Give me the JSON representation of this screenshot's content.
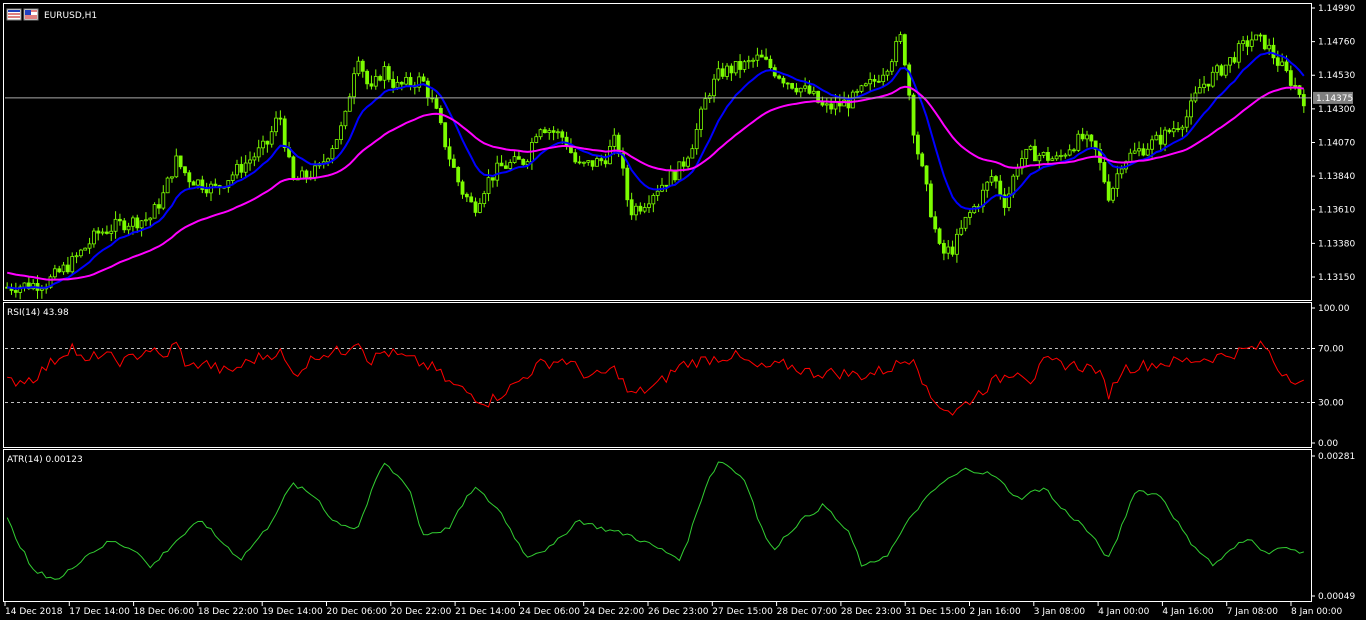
{
  "window": {
    "symbol_title": "EURUSD,H1",
    "icons": [
      "chart-window-icon",
      "flag-icon"
    ]
  },
  "colors": {
    "background": "#000000",
    "grid_border": "#ffffff",
    "candle_up": "#7cfc00",
    "candle_down": "#7cfc00",
    "ma_fast": "#0000ff",
    "ma_slow": "#ff00ff",
    "rsi_line": "#ff0000",
    "atr_line": "#32cd32",
    "level_line": "#c0c0c0"
  },
  "price_panel": {
    "y_ticks": [
      "1.14990",
      "1.14760",
      "1.14530",
      "1.14300",
      "1.14070",
      "1.13840",
      "1.13610",
      "1.13380",
      "1.13150"
    ],
    "current_price": "1.14375"
  },
  "rsi_panel": {
    "title": "RSI(14) 43.98",
    "y_ticks": [
      "100.00",
      "70.00",
      "30.00",
      "0.00"
    ],
    "levels": [
      70,
      30
    ]
  },
  "atr_panel": {
    "title": "ATR(14) 0.00123",
    "y_ticks": [
      "0.00281",
      "0.00049"
    ]
  },
  "x_axis": {
    "labels": [
      "14 Dec 2018",
      "17 Dec 14:00",
      "18 Dec 06:00",
      "18 Dec 22:00",
      "19 Dec 14:00",
      "20 Dec 06:00",
      "20 Dec 22:00",
      "21 Dec 14:00",
      "24 Dec 06:00",
      "24 Dec 22:00",
      "26 Dec 23:00",
      "27 Dec 15:00",
      "28 Dec 07:00",
      "28 Dec 23:00",
      "31 Dec 15:00",
      "2 Jan 16:00",
      "3 Jan 08:00",
      "4 Jan 00:00",
      "4 Jan 16:00",
      "7 Jan 08:00",
      "8 Jan 00:00"
    ]
  },
  "chart_data": [
    {
      "type": "candlestick",
      "title": "EURUSD,H1",
      "ylim": [
        1.1302,
        1.1499
      ],
      "x_range_labels": [
        "14 Dec 2018",
        "8 Jan 00:00"
      ],
      "close_profile": [
        [
          0,
          1.1308
        ],
        [
          0.03,
          1.1311
        ],
        [
          0.05,
          1.1325
        ],
        [
          0.07,
          1.1345
        ],
        [
          0.09,
          1.1352
        ],
        [
          0.11,
          1.1355
        ],
        [
          0.12,
          1.137
        ],
        [
          0.13,
          1.1395
        ],
        [
          0.14,
          1.1383
        ],
        [
          0.16,
          1.1375
        ],
        [
          0.18,
          1.139
        ],
        [
          0.2,
          1.1405
        ],
        [
          0.21,
          1.1427
        ],
        [
          0.22,
          1.138
        ],
        [
          0.24,
          1.1388
        ],
        [
          0.26,
          1.142
        ],
        [
          0.27,
          1.147
        ],
        [
          0.28,
          1.144
        ],
        [
          0.29,
          1.1458
        ],
        [
          0.3,
          1.1445
        ],
        [
          0.32,
          1.145
        ],
        [
          0.33,
          1.143
        ],
        [
          0.34,
          1.14
        ],
        [
          0.35,
          1.1375
        ],
        [
          0.36,
          1.1362
        ],
        [
          0.37,
          1.138
        ],
        [
          0.38,
          1.139
        ],
        [
          0.4,
          1.1395
        ],
        [
          0.41,
          1.142
        ],
        [
          0.43,
          1.141
        ],
        [
          0.44,
          1.139
        ],
        [
          0.46,
          1.1395
        ],
        [
          0.47,
          1.141
        ],
        [
          0.48,
          1.136
        ],
        [
          0.49,
          1.1365
        ],
        [
          0.5,
          1.1375
        ],
        [
          0.52,
          1.139
        ],
        [
          0.53,
          1.141
        ],
        [
          0.54,
          1.144
        ],
        [
          0.55,
          1.1455
        ],
        [
          0.57,
          1.146
        ],
        [
          0.58,
          1.1465
        ],
        [
          0.6,
          1.145
        ],
        [
          0.62,
          1.144
        ],
        [
          0.63,
          1.143
        ],
        [
          0.65,
          1.1435
        ],
        [
          0.67,
          1.145
        ],
        [
          0.68,
          1.1462
        ],
        [
          0.69,
          1.148
        ],
        [
          0.7,
          1.141
        ],
        [
          0.71,
          1.137
        ],
        [
          0.72,
          1.133
        ],
        [
          0.73,
          1.1335
        ],
        [
          0.74,
          1.1355
        ],
        [
          0.75,
          1.1368
        ],
        [
          0.76,
          1.1385
        ],
        [
          0.77,
          1.1365
        ],
        [
          0.78,
          1.1395
        ],
        [
          0.79,
          1.14
        ],
        [
          0.81,
          1.1395
        ],
        [
          0.82,
          1.1405
        ],
        [
          0.83,
          1.141
        ],
        [
          0.84,
          1.14
        ],
        [
          0.85,
          1.137
        ],
        [
          0.86,
          1.1395
        ],
        [
          0.88,
          1.1405
        ],
        [
          0.89,
          1.141
        ],
        [
          0.91,
          1.1425
        ],
        [
          0.92,
          1.1445
        ],
        [
          0.94,
          1.146
        ],
        [
          0.95,
          1.147
        ],
        [
          0.96,
          1.1478
        ],
        [
          0.97,
          1.1475
        ],
        [
          0.98,
          1.1462
        ],
        [
          1.0,
          1.1437
        ]
      ],
      "series": [
        {
          "role": "fast moving average",
          "color": "#0000ff"
        },
        {
          "role": "slow moving average",
          "color": "#ff00ff"
        }
      ],
      "current_price": 1.14375
    },
    {
      "type": "line",
      "title": "RSI(14) 43.98",
      "ylim": [
        0,
        100
      ],
      "levels": [
        70,
        30
      ],
      "profile": [
        [
          0,
          45
        ],
        [
          0.02,
          48
        ],
        [
          0.035,
          60
        ],
        [
          0.05,
          72
        ],
        [
          0.06,
          58
        ],
        [
          0.07,
          66
        ],
        [
          0.09,
          60
        ],
        [
          0.11,
          70
        ],
        [
          0.12,
          62
        ],
        [
          0.13,
          74
        ],
        [
          0.14,
          55
        ],
        [
          0.15,
          60
        ],
        [
          0.17,
          52
        ],
        [
          0.19,
          62
        ],
        [
          0.21,
          68
        ],
        [
          0.22,
          50
        ],
        [
          0.24,
          66
        ],
        [
          0.26,
          68
        ],
        [
          0.27,
          78
        ],
        [
          0.28,
          60
        ],
        [
          0.29,
          68
        ],
        [
          0.31,
          62
        ],
        [
          0.33,
          55
        ],
        [
          0.34,
          45
        ],
        [
          0.36,
          35
        ],
        [
          0.37,
          30
        ],
        [
          0.39,
          42
        ],
        [
          0.41,
          58
        ],
        [
          0.43,
          62
        ],
        [
          0.45,
          48
        ],
        [
          0.47,
          55
        ],
        [
          0.48,
          35
        ],
        [
          0.5,
          42
        ],
        [
          0.52,
          58
        ],
        [
          0.54,
          62
        ],
        [
          0.56,
          65
        ],
        [
          0.58,
          55
        ],
        [
          0.6,
          58
        ],
        [
          0.62,
          52
        ],
        [
          0.64,
          52
        ],
        [
          0.66,
          50
        ],
        [
          0.68,
          55
        ],
        [
          0.7,
          65
        ],
        [
          0.71,
          35
        ],
        [
          0.72,
          28
        ],
        [
          0.73,
          22
        ],
        [
          0.74,
          30
        ],
        [
          0.76,
          45
        ],
        [
          0.78,
          55
        ],
        [
          0.79,
          46
        ],
        [
          0.8,
          60
        ],
        [
          0.82,
          58
        ],
        [
          0.84,
          55
        ],
        [
          0.85,
          36
        ],
        [
          0.86,
          55
        ],
        [
          0.88,
          58
        ],
        [
          0.9,
          60
        ],
        [
          0.92,
          62
        ],
        [
          0.94,
          65
        ],
        [
          0.96,
          70
        ],
        [
          0.97,
          72
        ],
        [
          0.98,
          55
        ],
        [
          1.0,
          44
        ]
      ]
    },
    {
      "type": "line",
      "title": "ATR(14) 0.00123",
      "ylim": [
        0.00049,
        0.00281
      ],
      "profile": [
        [
          0,
          0.00176
        ],
        [
          0.02,
          0.0009
        ],
        [
          0.04,
          0.00076
        ],
        [
          0.06,
          0.00115
        ],
        [
          0.08,
          0.0014
        ],
        [
          0.1,
          0.00125
        ],
        [
          0.11,
          0.00095
        ],
        [
          0.13,
          0.0014
        ],
        [
          0.15,
          0.00175
        ],
        [
          0.16,
          0.0015
        ],
        [
          0.18,
          0.0011
        ],
        [
          0.2,
          0.0016
        ],
        [
          0.22,
          0.00235
        ],
        [
          0.24,
          0.0021
        ],
        [
          0.25,
          0.00175
        ],
        [
          0.27,
          0.0016
        ],
        [
          0.29,
          0.0027
        ],
        [
          0.31,
          0.0023
        ],
        [
          0.32,
          0.0015
        ],
        [
          0.34,
          0.0016
        ],
        [
          0.36,
          0.0023
        ],
        [
          0.38,
          0.0019
        ],
        [
          0.4,
          0.00115
        ],
        [
          0.42,
          0.0013
        ],
        [
          0.44,
          0.00175
        ],
        [
          0.46,
          0.0016
        ],
        [
          0.48,
          0.0015
        ],
        [
          0.5,
          0.0013
        ],
        [
          0.52,
          0.0011
        ],
        [
          0.54,
          0.0024
        ],
        [
          0.55,
          0.00275
        ],
        [
          0.57,
          0.0024
        ],
        [
          0.58,
          0.0017
        ],
        [
          0.59,
          0.00125
        ],
        [
          0.61,
          0.0017
        ],
        [
          0.63,
          0.002
        ],
        [
          0.65,
          0.0015
        ],
        [
          0.66,
          0.00095
        ],
        [
          0.68,
          0.0012
        ],
        [
          0.7,
          0.0019
        ],
        [
          0.72,
          0.00235
        ],
        [
          0.74,
          0.0026
        ],
        [
          0.76,
          0.0025
        ],
        [
          0.78,
          0.0021
        ],
        [
          0.8,
          0.0023
        ],
        [
          0.81,
          0.002
        ],
        [
          0.83,
          0.00165
        ],
        [
          0.85,
          0.0011
        ],
        [
          0.87,
          0.00225
        ],
        [
          0.89,
          0.00215
        ],
        [
          0.91,
          0.00145
        ],
        [
          0.93,
          0.001
        ],
        [
          0.95,
          0.00135
        ],
        [
          0.96,
          0.00145
        ],
        [
          0.97,
          0.0012
        ],
        [
          0.98,
          0.00128
        ],
        [
          1.0,
          0.00123
        ]
      ]
    }
  ]
}
